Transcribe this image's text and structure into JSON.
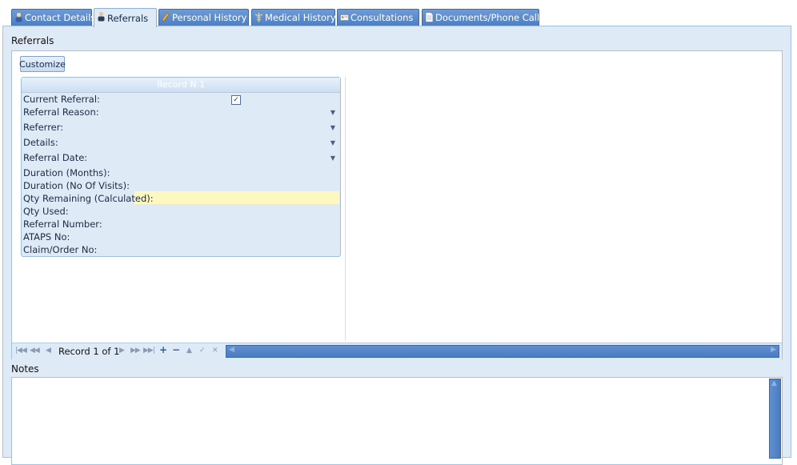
{
  "tabs": [
    {
      "label": "Contact Details",
      "icon": "contact-icon",
      "active": false
    },
    {
      "label": "Referrals",
      "icon": "referral-person-icon",
      "active": true
    },
    {
      "label": "Personal History",
      "icon": "pencil-icon",
      "active": false
    },
    {
      "label": "Medical History",
      "icon": "caduceus-icon",
      "active": false
    },
    {
      "label": "Consultations",
      "icon": "card-icon",
      "active": false
    },
    {
      "label": "Documents/Phone Calls",
      "icon": "document-icon",
      "active": false
    }
  ],
  "referrals": {
    "section_title": "Referrals",
    "customize_label": "Customize",
    "record_header": "Record N 1",
    "fields": {
      "current_referral": "Current Referral:",
      "current_referral_checked": true,
      "referral_reason": "Referral Reason:",
      "referrer": "Referrer:",
      "details": "Details:",
      "referral_date": "Referral Date:",
      "duration_months": "Duration (Months):",
      "duration_visits": "Duration (No Of Visits):",
      "qty_remaining": "Qty Remaining (Calculated):",
      "qty_used": "Qty Used:",
      "referral_number": "Referral Number:",
      "ataps_no": "ATAPS No:",
      "claim_order_no": "Claim/Order No:"
    },
    "navigator": {
      "record_text": "Record 1 of 1"
    }
  },
  "notes": {
    "section_title": "Notes"
  },
  "colors": {
    "panel_bg": "#dfeaf7",
    "tab_bg": "#5a8acb",
    "highlight": "#fdf8c0"
  }
}
